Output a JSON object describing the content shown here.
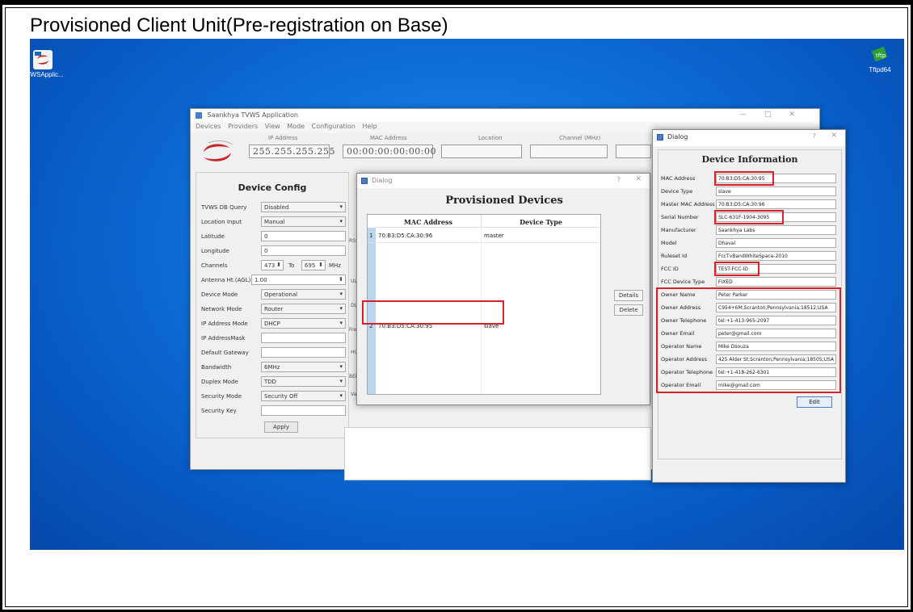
{
  "slide_title": "Provisioned Client Unit(Pre-registration on Base)",
  "desktop": {
    "left_icon_label": "TVWSApplic...",
    "right_icon_label": "Tftpd64"
  },
  "app": {
    "title": "Saankhya TVWS Application",
    "menu": [
      "Devices",
      "Providers",
      "View",
      "Mode",
      "Configuration",
      "Help"
    ],
    "header": {
      "ip_label": "IP Address",
      "ip_value": "255.255.255.255",
      "mac_label": "MAC Address",
      "mac_value": "00:00:00:00:00:00",
      "location_label": "Location",
      "channel_label": "Channel (MHz)"
    },
    "device_config": {
      "title": "Device Config",
      "rows": [
        {
          "label": "TVWS DB Query",
          "value": "Disabled"
        },
        {
          "label": "Location Input",
          "value": "Manual"
        },
        {
          "label": "Latitude",
          "value": "0"
        },
        {
          "label": "Longitude",
          "value": "0"
        },
        {
          "label": "Channels",
          "value": "473",
          "to_label": "To",
          "value2": "695",
          "unit": "MHz"
        },
        {
          "label": "Antenna Ht.(AGL)",
          "value": "1.00"
        },
        {
          "label": "Device Mode",
          "value": "Operational"
        },
        {
          "label": "Network Mode",
          "value": "Router"
        },
        {
          "label": "IP Address Mode",
          "value": "DHCP"
        },
        {
          "label": "IP AddressMask",
          "value": ""
        },
        {
          "label": "Default Gateway",
          "value": ""
        },
        {
          "label": "Bandwidth",
          "value": "6MHz"
        },
        {
          "label": "Duplex Mode",
          "value": "TDD"
        },
        {
          "label": "Security Mode",
          "value": "Security Off"
        },
        {
          "label": "Security Key",
          "value": ""
        }
      ],
      "apply_label": "Apply"
    },
    "mid_labels": [
      "RSS",
      "UL",
      "DL",
      "Fre",
      "HC",
      "BER",
      "Va"
    ]
  },
  "provisioned_dialog": {
    "window_title": "Dialog",
    "help": "?",
    "close": "✕",
    "title": "Provisioned Devices",
    "columns": [
      "MAC Address",
      "Device Type"
    ],
    "rows": [
      {
        "num": "1",
        "mac": "70:B3:D5:CA:30:96",
        "type": "master"
      },
      {
        "num": "2",
        "mac": "70:B3:D5:CA:30:95",
        "type": "slave"
      }
    ],
    "details_label": "Details",
    "delete_label": "Delete"
  },
  "device_info_dialog": {
    "window_title": "Dialog",
    "help": "?",
    "close": "✕",
    "title": "Device Information",
    "fields": [
      {
        "label": "MAC Address",
        "value": "70:B3:D5:CA:30:95"
      },
      {
        "label": "Device Type",
        "value": "slave"
      },
      {
        "label": "Master MAC Address",
        "value": "70:B3:D5:CA:30:96"
      },
      {
        "label": "Serial Number",
        "value": "SLC-631F-1904-3095"
      },
      {
        "label": "Manufacturer",
        "value": "Saankhya Labs"
      },
      {
        "label": "Model",
        "value": "Dhaval"
      },
      {
        "label": "Ruleset Id",
        "value": "FccTvBandWhiteSpace-2010"
      },
      {
        "label": "FCC ID",
        "value": "TEST-FCC-ID"
      },
      {
        "label": "FCC Device Type",
        "value": "FIXED"
      },
      {
        "label": "Owner Name",
        "value": "Peter Parker"
      },
      {
        "label": "Owner Address",
        "value": "C954+6M;Scranton;Pennsylvania;18512;USA"
      },
      {
        "label": "Owner Telephone",
        "value": "tel:+1-413-965-2097"
      },
      {
        "label": "Owner Email",
        "value": "peter@gmail.com"
      },
      {
        "label": "Operator Name",
        "value": "Mike Dsouza"
      },
      {
        "label": "Operator Address",
        "value": "425 Alder St;Scranton;Pennsylvania;18505;USA"
      },
      {
        "label": "Operator Telephone",
        "value": "tel:+1-418-262-6301"
      },
      {
        "label": "Operator Email",
        "value": "mike@gmail.com"
      }
    ],
    "edit_label": "Edit"
  },
  "colors": {
    "highlight": "#d8222a",
    "desktop": "#0f6fd8"
  }
}
